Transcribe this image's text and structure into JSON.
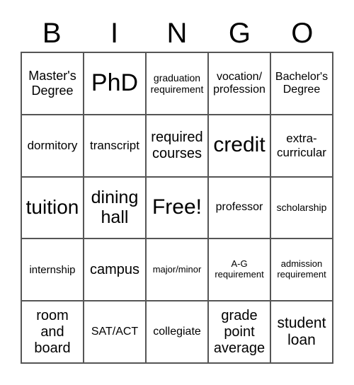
{
  "header": [
    "B",
    "I",
    "N",
    "G",
    "O"
  ],
  "cells": [
    [
      "Master's Degree",
      "PhD",
      "graduation requirement",
      "vocation/ profession",
      "Bachelor's Degree"
    ],
    [
      "dormitory",
      "transcript",
      "required courses",
      "credit",
      "extra- curricular"
    ],
    [
      "tuition",
      "dining hall",
      "Free!",
      "professor",
      "scholarship"
    ],
    [
      "internship",
      "campus",
      "major/minor",
      "A-G requirement",
      "admission requirement"
    ],
    [
      "room and board",
      "SAT/ACT",
      "collegiate",
      "grade point average",
      "student loan"
    ]
  ]
}
